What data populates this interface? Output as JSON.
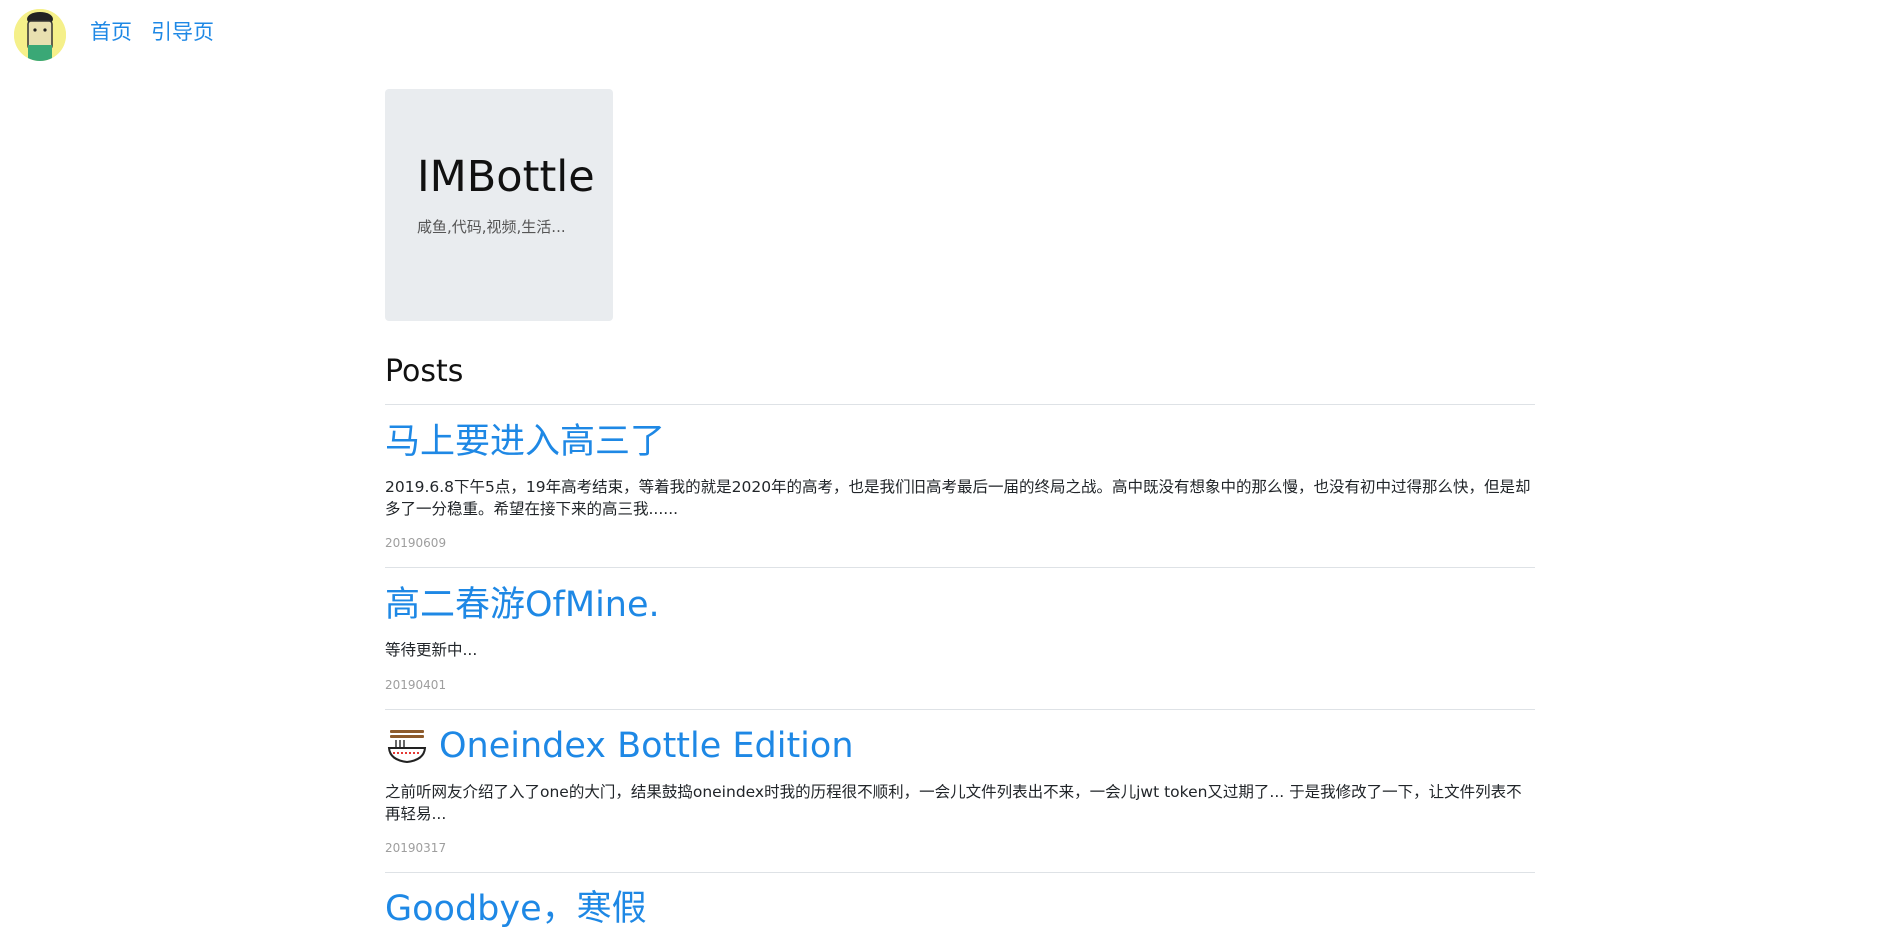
{
  "nav": {
    "home": "首页",
    "guide": "引导页"
  },
  "jumbotron": {
    "title": "IMBottle",
    "subtitle": "咸鱼,代码,视频,生活..."
  },
  "posts_heading": "Posts",
  "posts": [
    {
      "title": "马上要进入高三了",
      "excerpt": "2019.6.8下午5点，19年高考结束，等着我的就是2020年的高考，也是我们旧高考最后一届的终局之战。高中既没有想象中的那么慢，也没有初中过得那么快，但是却多了一分稳重。希望在接下来的高三我......",
      "date": "20190609"
    },
    {
      "title": "高二春游OfMine.",
      "excerpt": "等待更新中...",
      "date": "20190401"
    },
    {
      "title": "Oneindex Bottle Edition",
      "excerpt": "  之前听网友介绍了入了one的大门，结果鼓捣oneindex时我的历程很不顺利，一会儿文件列表出不来，一会儿jwt token又过期了... 于是我修改了一下，让文件列表不再轻易...",
      "date": "20190317",
      "icon": "noodle-bowl-icon"
    },
    {
      "title": "Goodbye，寒假"
    }
  ],
  "colors": {
    "link": "#1e88e5",
    "jumbotron_bg": "#e9ecef",
    "date": "#9e9e9e"
  }
}
